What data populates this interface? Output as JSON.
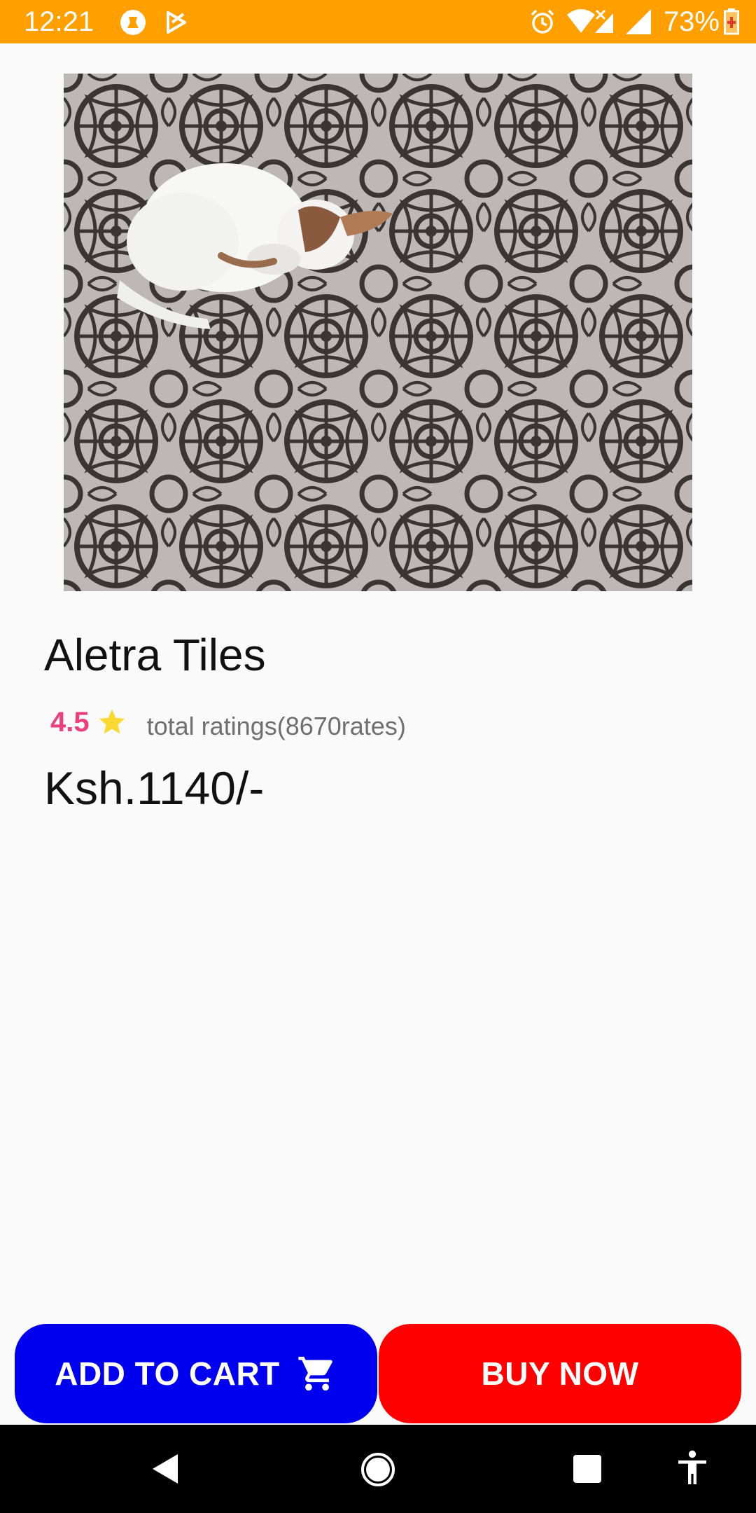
{
  "status_bar": {
    "time": "12:21",
    "battery_percent": "73%",
    "background_color": "#ffa000",
    "icons": [
      "notification-app-icon",
      "play-store-icon",
      "alarm-icon",
      "wifi-icon",
      "signal-icon",
      "battery-icon"
    ]
  },
  "product": {
    "image_alt": "white dog sleeping on patterned tile",
    "name": "Aletra Tiles",
    "rating": "4.5",
    "rating_text": "total ratings(8670rates)",
    "price": "Ksh.1140/-"
  },
  "actions": {
    "add_to_cart_label": "ADD TO CART",
    "buy_now_label": "BUY NOW",
    "add_to_cart_color": "#0000ee",
    "buy_now_color": "#ff0000"
  },
  "colors": {
    "rating_accent": "#ec407a",
    "star": "#fdd835"
  },
  "nav_bar": {
    "icons": [
      "back-icon",
      "home-icon",
      "recents-icon",
      "accessibility-icon"
    ]
  }
}
